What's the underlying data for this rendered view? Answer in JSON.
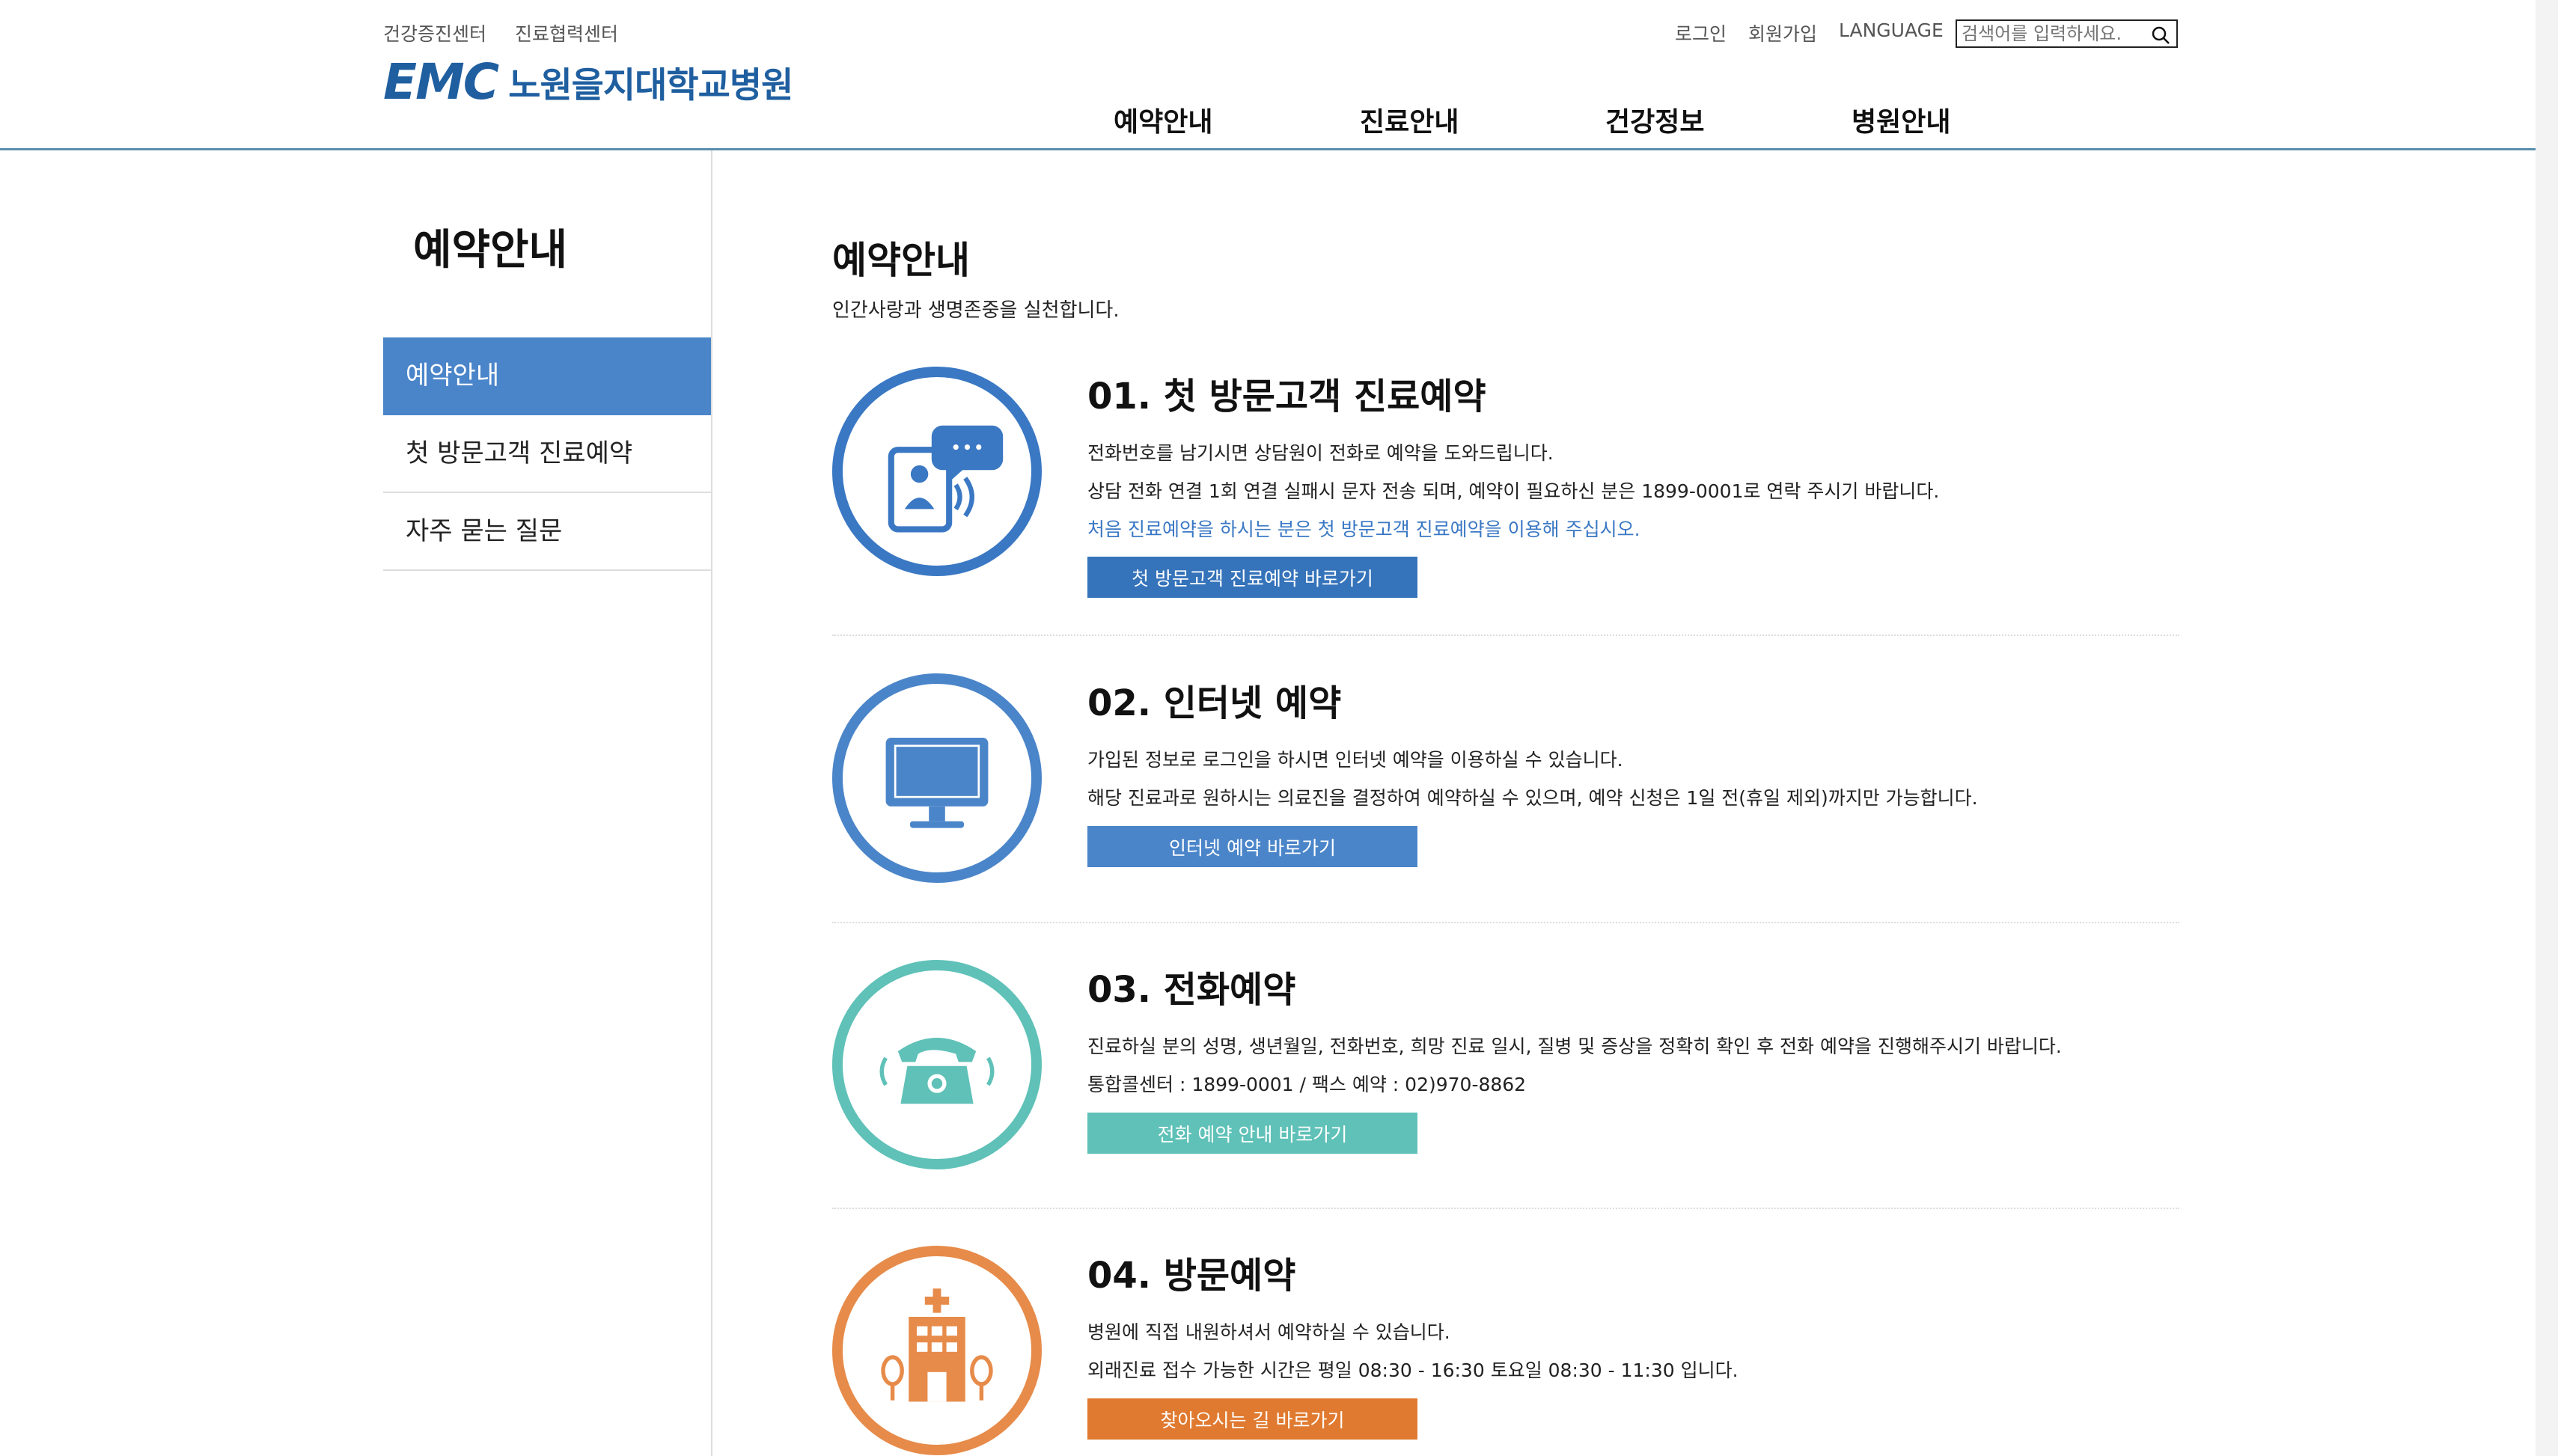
{
  "header": {
    "top_links_left": [
      "건강증진센터",
      "진료협력센터"
    ],
    "top_links_right": [
      "로그인",
      "회원가입",
      "LANGUAGE"
    ],
    "logo_mark": "EMC",
    "logo_name": "노원을지대학교병원",
    "search_placeholder": "검색어를 입력하세요.",
    "gnb": [
      "예약안내",
      "진료안내",
      "건강정보",
      "병원안내"
    ]
  },
  "sidebar": {
    "title": "예약안내",
    "items": [
      "예약안내",
      "첫 방문고객 진료예약",
      "자주 묻는 질문"
    ],
    "active_index": 0
  },
  "main": {
    "title": "예약안내",
    "subtitle": "인간사랑과 생명존중을 실천합니다.",
    "sections": [
      {
        "heading": "01. 첫 방문고객 진료예약",
        "icon": "mobile-call-icon",
        "color": "#3a78c4",
        "lines": [
          "전화번호를 남기시면 상담원이 전화로 예약을 도와드립니다.",
          "상담 전화 연결 1회 연결 실패시 문자 전송 되며, 예약이 필요하신 분은 1899-0001로 연락 주시기 바랍니다."
        ],
        "note": "처음 진료예약을 하시는 분은 첫 방문고객 진료예약을 이용해 주십시오.",
        "button": "첫 방문고객 진료예약 바로가기"
      },
      {
        "heading": "02. 인터넷 예약",
        "icon": "monitor-icon",
        "color": "#4b85c9",
        "lines": [
          "가입된 정보로 로그인을 하시면 인터넷 예약을 이용하실 수 있습니다.",
          "해당 진료과로 원하시는 의료진을 결정하여 예약하실 수 있으며, 예약 신청은 1일 전(휴일 제외)까지만 가능합니다."
        ],
        "button": "인터넷 예약 바로가기"
      },
      {
        "heading": "03. 전화예약",
        "icon": "telephone-icon",
        "color": "#5fc1b7",
        "lines": [
          "진료하실 분의 성명, 생년월일, 전화번호, 희망 진료 일시, 질병 및 증상을 정확히 확인 후 전화 예약을 진행해주시기 바랍니다.",
          "통합콜센터 : 1899-0001 / 팩스 예약 : 02)970-8862"
        ],
        "button": "전화 예약 안내 바로가기"
      },
      {
        "heading": "04. 방문예약",
        "icon": "hospital-building-icon",
        "color": "#e78b4a",
        "lines": [
          "병원에 직접 내원하셔서 예약하실 수 있습니다.",
          "외래진료 접수 가능한 시간은 평일 08:30 - 16:30 토요일 08:30 - 11:30 입니다."
        ],
        "button": "찾아오시는 길 바로가기"
      }
    ]
  },
  "colors": {
    "brand": "#1f5fa0",
    "side_active": "#4b85c9",
    "btn_blue_dark": "#3573ba",
    "btn_blue": "#4b85c9",
    "btn_teal": "#5fc1b7",
    "btn_orange": "#e07a30"
  }
}
